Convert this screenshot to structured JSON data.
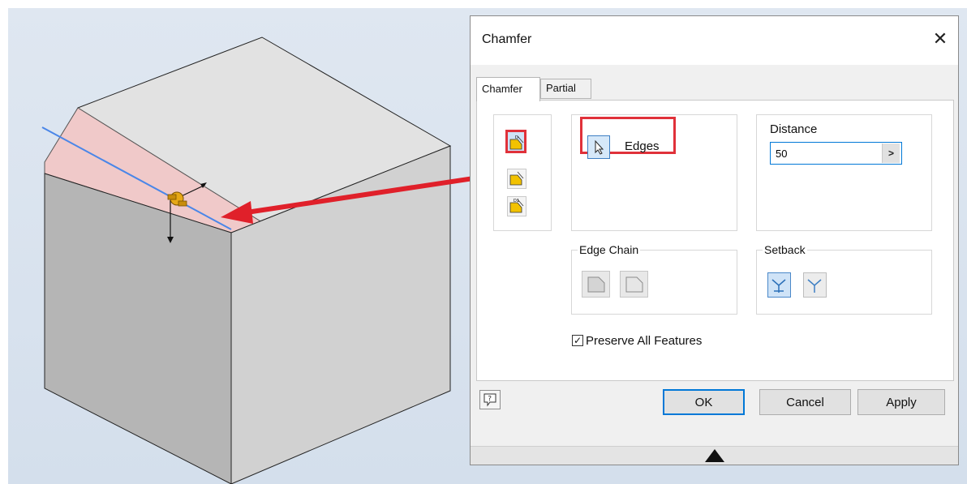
{
  "dialog": {
    "title": "Chamfer",
    "close_icon": "close-icon",
    "tabs": [
      {
        "label": "Chamfer",
        "active": true
      },
      {
        "label": "Partial",
        "active": false
      }
    ],
    "modes": [
      {
        "icon": "chamfer-distance-icon",
        "selected": true
      },
      {
        "icon": "chamfer-distance-angle-icon",
        "selected": false
      },
      {
        "icon": "chamfer-two-distances-icon",
        "selected": false
      }
    ],
    "edges": {
      "label": "Edges",
      "icon": "cursor-arrow-icon"
    },
    "distance": {
      "label": "Distance",
      "value": "50",
      "arrow": ">"
    },
    "edge_chain": {
      "label": "Edge Chain",
      "buttons": [
        "edge-chain-all-icon",
        "edge-chain-single-icon"
      ]
    },
    "setback": {
      "label": "Setback",
      "buttons": [
        "setback-on-icon",
        "setback-off-icon"
      ]
    },
    "preserve": {
      "label": "Preserve All Features",
      "checked": true,
      "mark": "✓"
    },
    "buttons": {
      "ok": "OK",
      "cancel": "Cancel",
      "apply": "Apply"
    },
    "help_icon": "help-icon",
    "expand_icon": "expand-triangle-icon"
  },
  "colors": {
    "accent": "#0078d7",
    "highlight": "#e0313a",
    "face_selection": "#f0b8b8",
    "edge_selection": "#4a86e8"
  }
}
